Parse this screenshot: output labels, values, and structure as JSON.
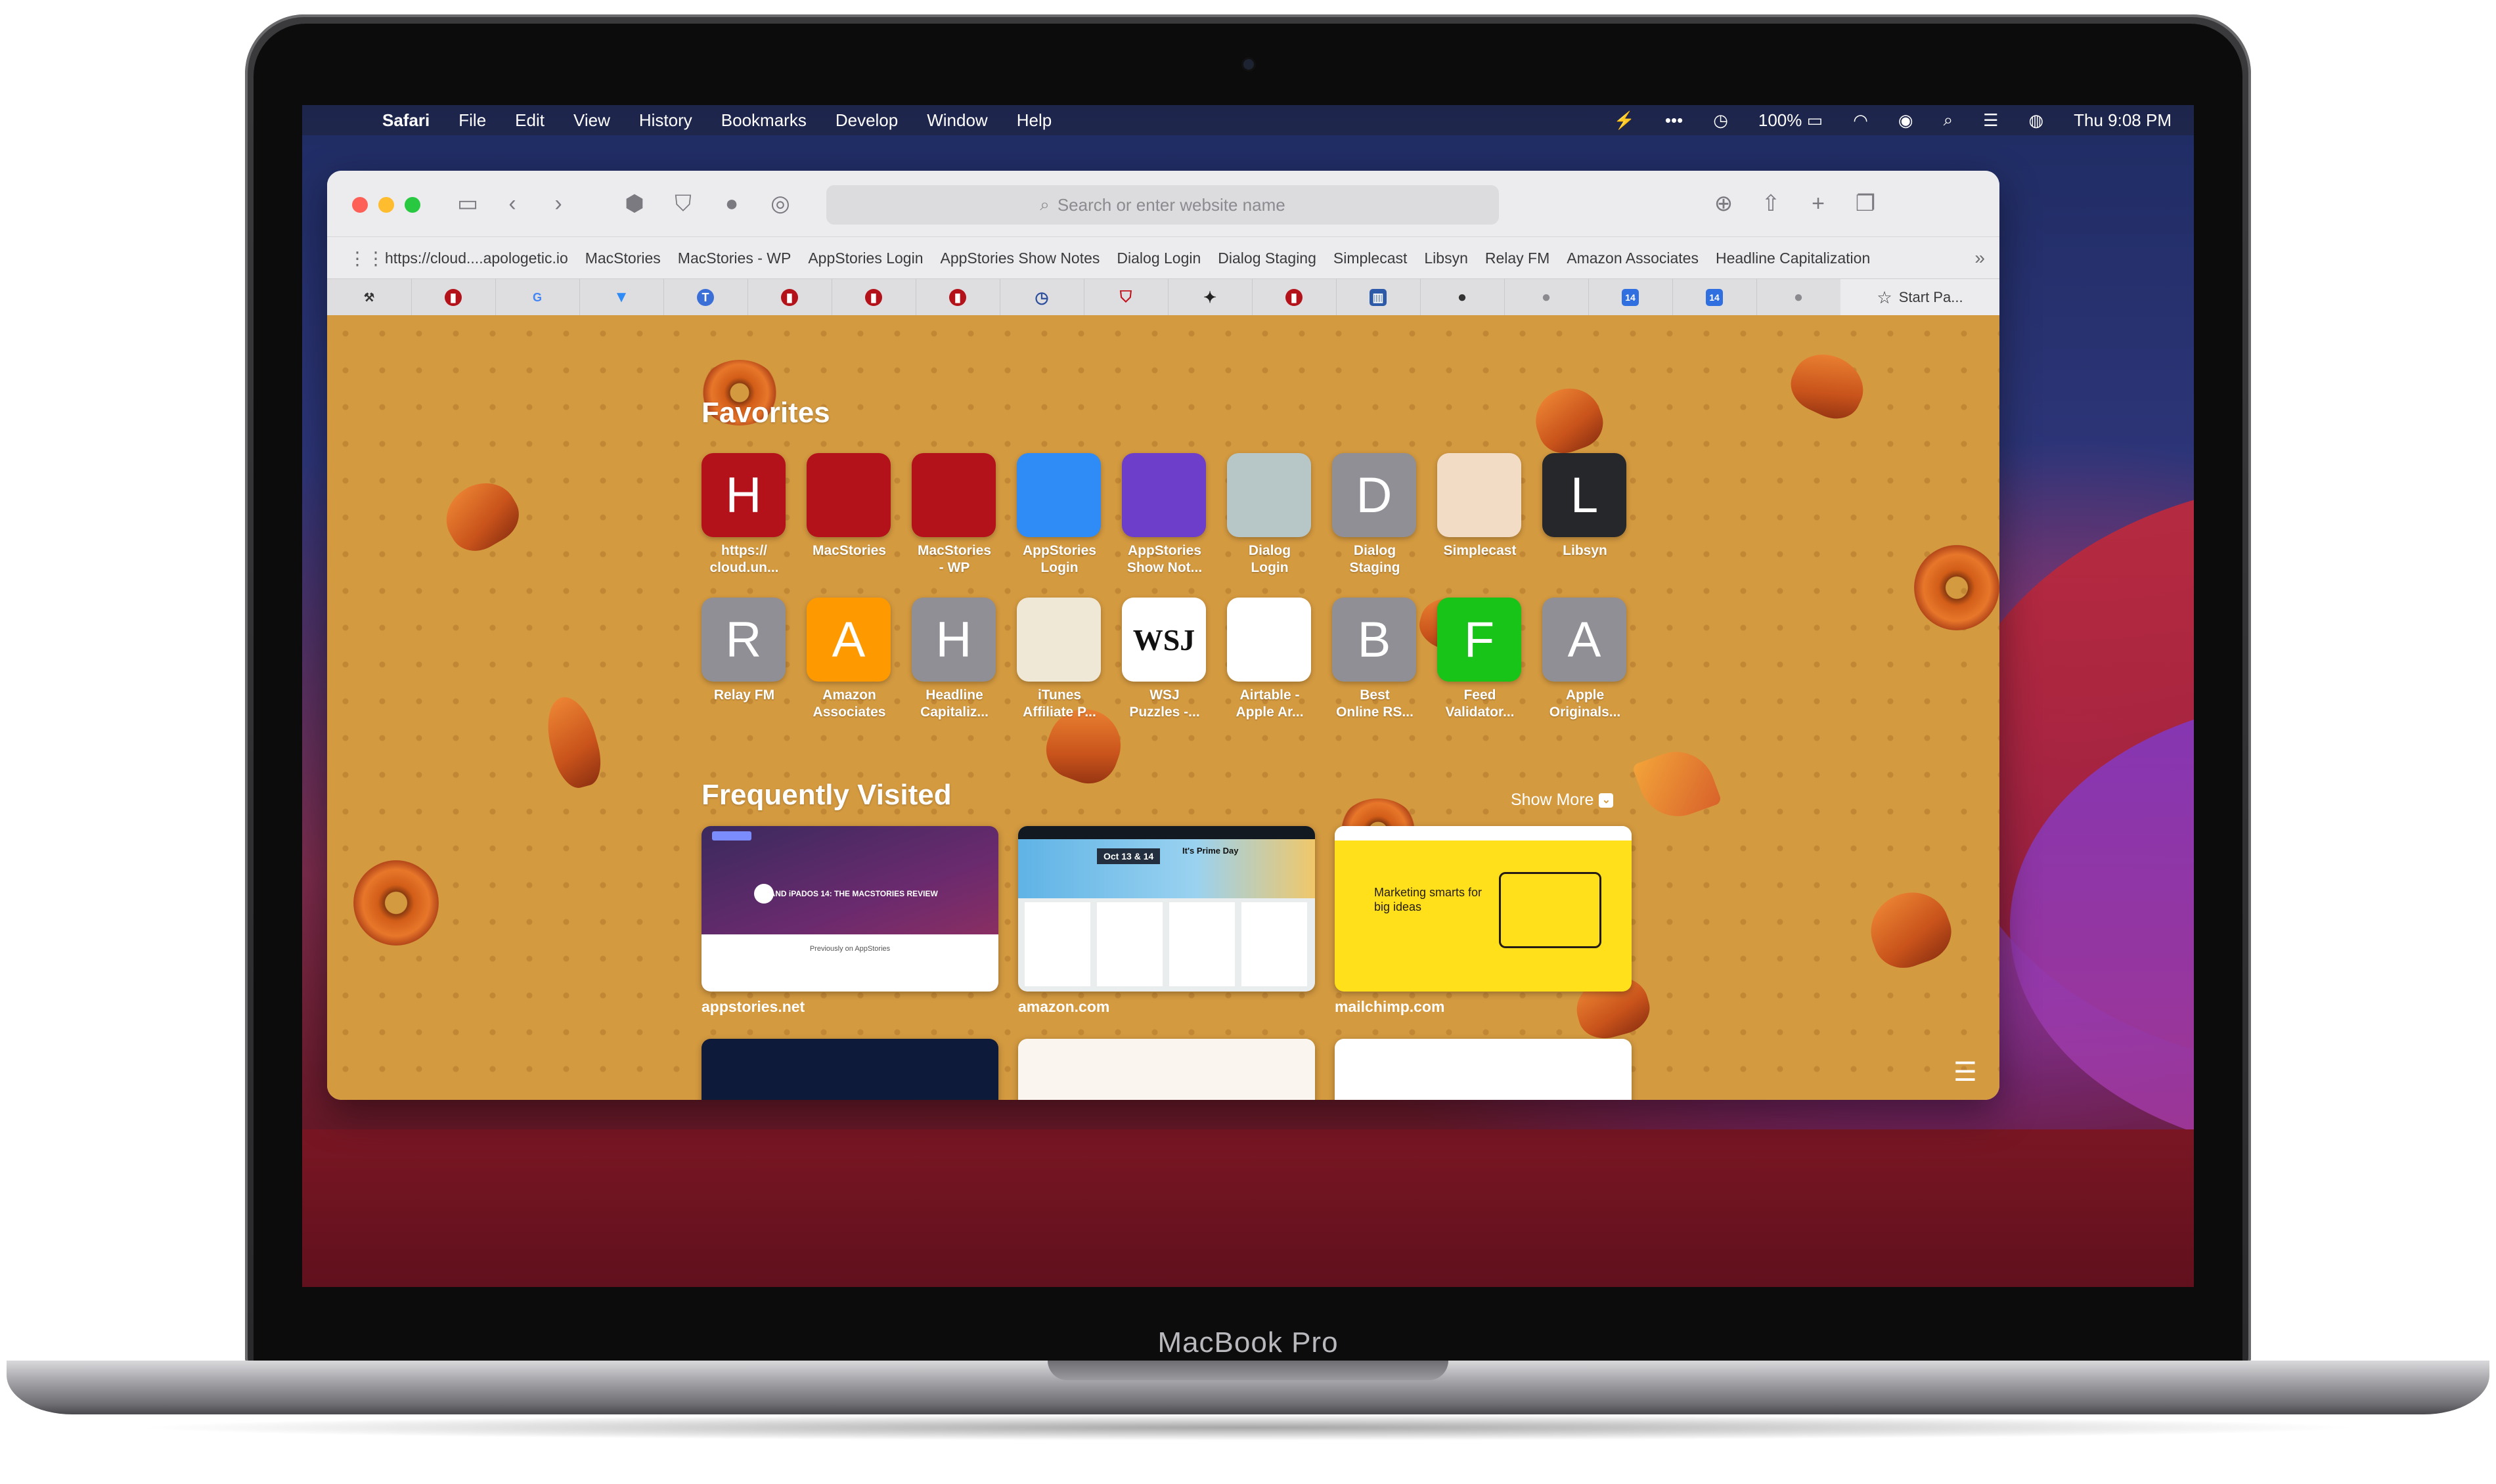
{
  "device": {
    "brand": "MacBook Pro"
  },
  "menubar": {
    "app": "Safari",
    "items": [
      "File",
      "Edit",
      "View",
      "History",
      "Bookmarks",
      "Develop",
      "Window",
      "Help"
    ],
    "battery": "100%",
    "clock": "Thu 9:08 PM"
  },
  "toolbar": {
    "address_placeholder": "Search or enter website name"
  },
  "favorites_bar": {
    "items": [
      "https://cloud....apologetic.io",
      "MacStories",
      "MacStories - WP",
      "AppStories Login",
      "AppStories Show Notes",
      "Dialog Login",
      "Dialog Staging",
      "Simplecast",
      "Libsyn",
      "Relay FM",
      "Amazon Associates",
      "Headline Capitalization"
    ]
  },
  "tabs": {
    "start_page_label": "Start Pa...",
    "icons": [
      "tools",
      "macstories",
      "google",
      "bookmark",
      "nyt",
      "macstories",
      "macstories",
      "macstories",
      "clock",
      "shield",
      "runner",
      "macstories",
      "chart",
      "apple",
      "apple",
      "calendar",
      "calendar",
      "apple"
    ]
  },
  "favorites": {
    "title": "Favorites",
    "row1": [
      {
        "letter": "H",
        "label": "https://\ncloud.un...",
        "color": "#b4121b"
      },
      {
        "letter": "",
        "label": "MacStories",
        "color": "#b4121b"
      },
      {
        "letter": "",
        "label": "MacStories\n- WP",
        "color": "#b4121b"
      },
      {
        "letter": "",
        "label": "AppStories\nLogin",
        "color": "#2f8bf5"
      },
      {
        "letter": "",
        "label": "AppStories\nShow Not...",
        "color": "#6c3ec9"
      },
      {
        "letter": "",
        "label": "Dialog\nLogin",
        "color": "#b7c6c6"
      },
      {
        "letter": "D",
        "label": "Dialog\nStaging",
        "color": "#8f8f95"
      },
      {
        "letter": "",
        "label": "Simplecast",
        "color": "#f3dcc6"
      },
      {
        "letter": "L",
        "label": "Libsyn",
        "color": "#26272b"
      }
    ],
    "row2": [
      {
        "letter": "R",
        "label": "Relay FM",
        "color": "#8f8f95"
      },
      {
        "letter": "A",
        "label": "Amazon\nAssociates",
        "color": "#ff9900"
      },
      {
        "letter": "H",
        "label": "Headline\nCapitaliz...",
        "color": "#8f8f95"
      },
      {
        "letter": "",
        "label": "iTunes\nAffiliate P...",
        "color": "#efe8d6"
      },
      {
        "letter": "WSJ",
        "label": "WSJ\nPuzzles -...",
        "color": "#ffffff"
      },
      {
        "letter": "",
        "label": "Airtable -\nApple Ar...",
        "color": "#ffffff"
      },
      {
        "letter": "B",
        "label": "Best\nOnline RS...",
        "color": "#8f8f95"
      },
      {
        "letter": "F",
        "label": "Feed\nValidator...",
        "color": "#17c417"
      },
      {
        "letter": "A",
        "label": "Apple\nOriginals...",
        "color": "#8f8f95"
      }
    ]
  },
  "frequently_visited": {
    "title": "Frequently Visited",
    "show_more": "Show More",
    "sites": [
      {
        "label": "appstories.net"
      },
      {
        "label": "amazon.com"
      },
      {
        "label": "mailchimp.com"
      }
    ],
    "appstories_headline": "iOS AND iPADOS 14: THE MACSTORIES REVIEW",
    "appstories_sub": "Previously on AppStories",
    "amazon_banner": "It's Prime Day",
    "amazon_date": "Oct 13 & 14",
    "mailchimp_headline": "Marketing smarts for big ideas"
  }
}
